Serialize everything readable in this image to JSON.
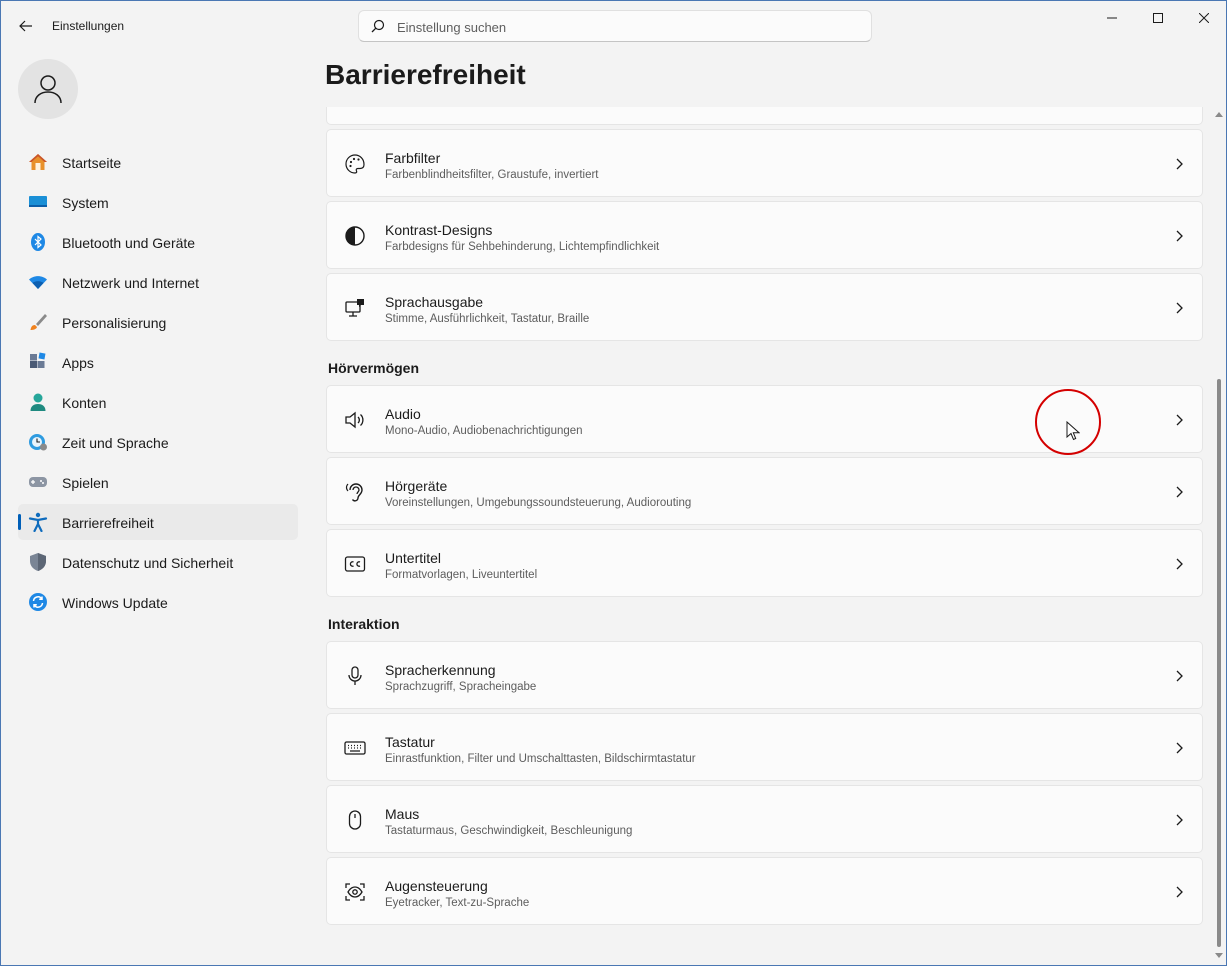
{
  "app": {
    "title": "Einstellungen"
  },
  "search": {
    "placeholder": "Einstellung suchen"
  },
  "sidebar": {
    "items": [
      {
        "label": "Startseite",
        "icon": "home-icon"
      },
      {
        "label": "System",
        "icon": "system-icon"
      },
      {
        "label": "Bluetooth und Geräte",
        "icon": "bluetooth-icon"
      },
      {
        "label": "Netzwerk und Internet",
        "icon": "wifi-icon"
      },
      {
        "label": "Personalisierung",
        "icon": "brush-icon"
      },
      {
        "label": "Apps",
        "icon": "apps-icon"
      },
      {
        "label": "Konten",
        "icon": "account-icon"
      },
      {
        "label": "Zeit und Sprache",
        "icon": "time-language-icon"
      },
      {
        "label": "Spielen",
        "icon": "gamepad-icon"
      },
      {
        "label": "Barrierefreiheit",
        "icon": "accessibility-icon",
        "selected": true
      },
      {
        "label": "Datenschutz und Sicherheit",
        "icon": "shield-icon"
      },
      {
        "label": "Windows Update",
        "icon": "update-icon"
      }
    ]
  },
  "main": {
    "title": "Barrierefreiheit",
    "cards_vision": [
      {
        "title": "Farbfilter",
        "subtitle": "Farbenblindheitsfilter, Graustufe, invertiert",
        "icon": "palette-icon"
      },
      {
        "title": "Kontrast-Designs",
        "subtitle": "Farbdesigns für Sehbehinderung, Lichtempfindlichkeit",
        "icon": "contrast-icon"
      },
      {
        "title": "Sprachausgabe",
        "subtitle": "Stimme, Ausführlichkeit, Tastatur, Braille",
        "icon": "narrator-icon"
      }
    ],
    "section_hearing": "Hörvermögen",
    "cards_hearing": [
      {
        "title": "Audio",
        "subtitle": "Mono-Audio, Audiobenachrichtigungen",
        "icon": "speaker-icon"
      },
      {
        "title": "Hörgeräte",
        "subtitle": "Voreinstellungen, Umgebungssoundsteuerung, Audiorouting",
        "icon": "ear-icon"
      },
      {
        "title": "Untertitel",
        "subtitle": "Formatvorlagen, Liveuntertitel",
        "icon": "captions-icon"
      }
    ],
    "section_interaction": "Interaktion",
    "cards_interaction": [
      {
        "title": "Spracherkennung",
        "subtitle": "Sprachzugriff, Spracheingabe",
        "icon": "microphone-icon"
      },
      {
        "title": "Tastatur",
        "subtitle": "Einrastfunktion, Filter und Umschalttasten, Bildschirmtastatur",
        "icon": "keyboard-icon"
      },
      {
        "title": "Maus",
        "subtitle": "Tastaturmaus, Geschwindigkeit, Beschleunigung",
        "icon": "mouse-icon"
      },
      {
        "title": "Augensteuerung",
        "subtitle": "Eyetracker, Text-zu-Sprache",
        "icon": "eye-control-icon"
      }
    ]
  },
  "colors": {
    "accent": "#005fb8",
    "background": "#f3f3f3",
    "card": "#fbfbfb"
  }
}
